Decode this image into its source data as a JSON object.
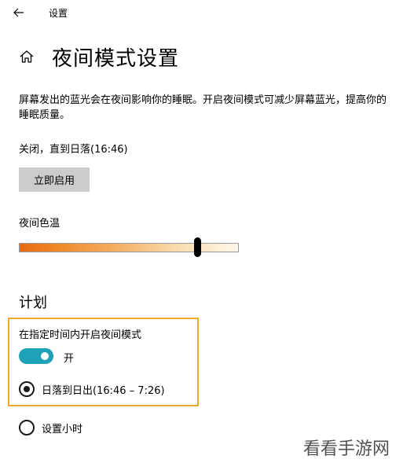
{
  "window": {
    "app_title": "设置"
  },
  "header": {
    "title": "夜间模式设置"
  },
  "description": "屏幕发出的蓝光会在夜间影响你的睡眠。开启夜间模式可减少屏幕蓝光，提高你的睡眠质量。",
  "status_text": "关闭，直到日落(16:46)",
  "enable_button_label": "立即启用",
  "color_temperature": {
    "label": "夜间色温",
    "level": 0.81
  },
  "schedule": {
    "section_title": "计划",
    "toggle_label": "在指定时间内开启夜间模式",
    "toggle_state_text": "开",
    "toggle_on": true,
    "options": [
      {
        "label": "日落到日出(16:46 – 7:26)",
        "selected": true
      },
      {
        "label": "设置小时",
        "selected": false
      }
    ]
  },
  "watermark": "看看手游网",
  "colors": {
    "accent": "#1fa1b8",
    "highlight_border": "#f0a92a",
    "button_bg": "#cccccc"
  }
}
